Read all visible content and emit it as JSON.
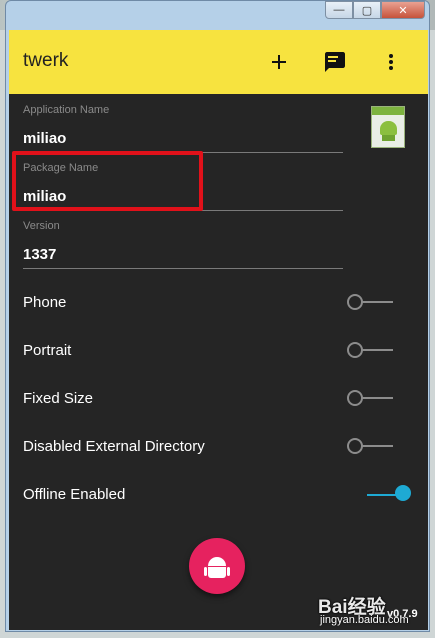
{
  "app": {
    "title": "twerk"
  },
  "toolbar": {
    "add_icon": "plus-icon",
    "feedback_icon": "feedback-icon",
    "menu_icon": "more-vert-icon"
  },
  "fields": {
    "application_name": {
      "label": "Application Name",
      "value": "miliao"
    },
    "package_name": {
      "label": "Package Name",
      "value": "miliao"
    },
    "version": {
      "label": "Version",
      "value": "1337"
    }
  },
  "options": [
    {
      "label": "Phone",
      "enabled": false
    },
    {
      "label": "Portrait",
      "enabled": false
    },
    {
      "label": "Fixed Size",
      "enabled": false
    },
    {
      "label": "Disabled External Directory",
      "enabled": false
    },
    {
      "label": "Offline Enabled",
      "enabled": true
    }
  ],
  "fab": {
    "icon": "android-icon"
  },
  "version_tag": "v0.7.9",
  "watermark": {
    "brand": "Bai经验",
    "url": "jingyan.baidu.com"
  },
  "colors": {
    "appbar": "#f7e33f",
    "background": "#252525",
    "accent": "#1eaad4",
    "fab": "#e6225f",
    "highlight": "#e1111a"
  }
}
